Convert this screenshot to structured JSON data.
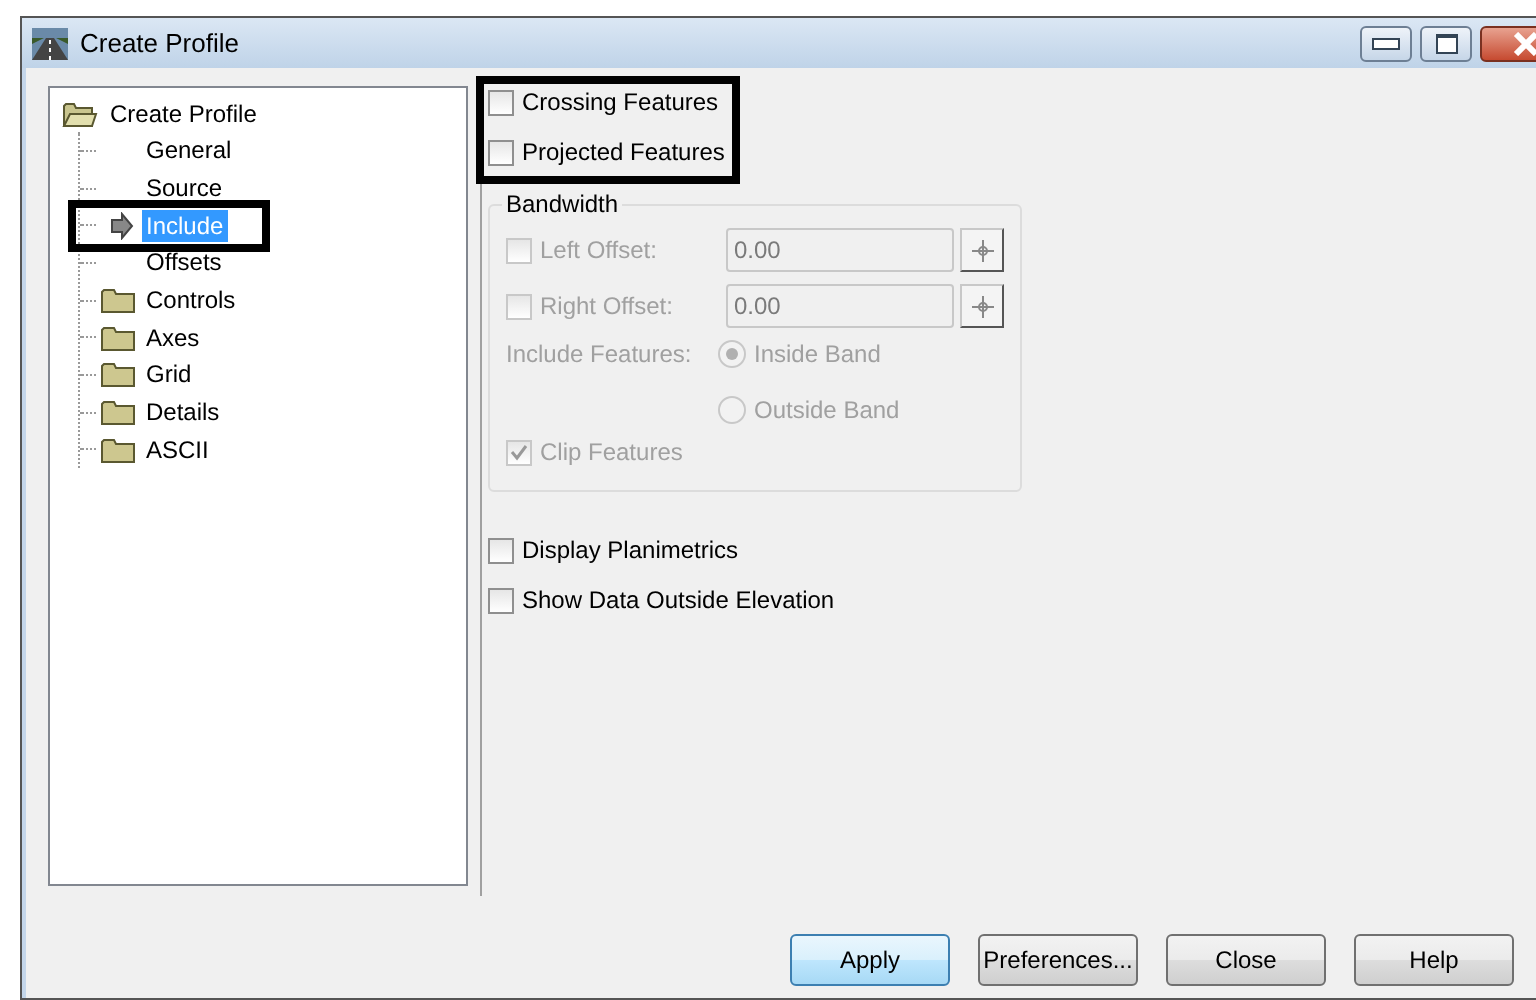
{
  "window": {
    "title": "Create Profile"
  },
  "tree": {
    "label": "Create Profile",
    "expanded": true,
    "children": [
      {
        "label": "General",
        "kind": "page",
        "selected": false
      },
      {
        "label": "Source",
        "kind": "page",
        "selected": false
      },
      {
        "label": "Include",
        "kind": "page",
        "selected": true
      },
      {
        "label": "Offsets",
        "kind": "page",
        "selected": false
      },
      {
        "label": "Controls",
        "kind": "folder",
        "selected": false
      },
      {
        "label": "Axes",
        "kind": "folder",
        "selected": false
      },
      {
        "label": "Grid",
        "kind": "folder",
        "selected": false
      },
      {
        "label": "Details",
        "kind": "folder",
        "selected": false
      },
      {
        "label": "ASCII",
        "kind": "folder",
        "selected": false
      }
    ]
  },
  "top_options": [
    {
      "label": "Crossing Features",
      "checked": false
    },
    {
      "label": "Projected Features",
      "checked": false
    }
  ],
  "bandwidth": {
    "title": "Bandwidth",
    "disabled": true,
    "offsets": [
      {
        "label": "Left Offset:",
        "checked": false,
        "value": "0.00"
      },
      {
        "label": "Right Offset:",
        "checked": false,
        "value": "0.00"
      }
    ],
    "include_label": "Include Features:",
    "radios": [
      {
        "label": "Inside Band",
        "selected": true
      },
      {
        "label": "Outside Band",
        "selected": false
      }
    ],
    "clip": {
      "label": "Clip Features",
      "checked": true
    }
  },
  "bottom_options": [
    {
      "label": "Display Planimetrics",
      "checked": false
    },
    {
      "label": "Show Data Outside Elevation",
      "checked": false
    }
  ],
  "buttons": [
    {
      "label": "Apply",
      "default": true
    },
    {
      "label": "Preferences...",
      "default": false
    },
    {
      "label": "Close",
      "default": false
    },
    {
      "label": "Help",
      "default": false
    }
  ]
}
